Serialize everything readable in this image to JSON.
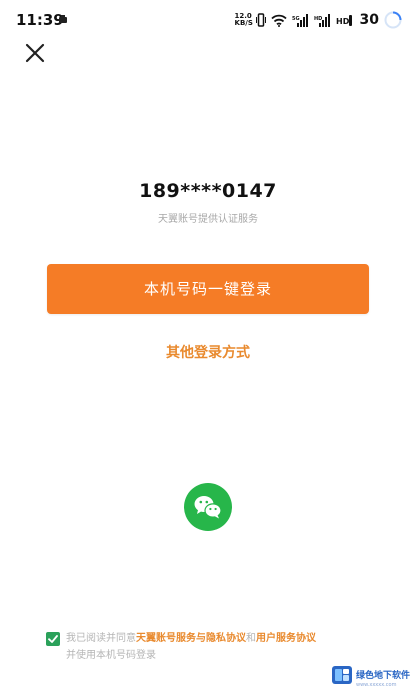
{
  "status_bar": {
    "time": "11:39",
    "net_speed_value": "12.0",
    "net_speed_unit": "KB/S",
    "battery": "30"
  },
  "login": {
    "phone_number": "189****0147",
    "auth_note": "天翼账号提供认证服务",
    "one_click_login_label": "本机号码一键登录",
    "other_login_label": "其他登录方式"
  },
  "agreement": {
    "prefix": "我已阅读并同意",
    "terms_link": "天翼账号服务与隐私协议",
    "conjunction": "和",
    "user_link": "用户服务协议",
    "line2": "并使用本机号码登录",
    "checked": true
  },
  "watermark": {
    "text": "绿色地下软件",
    "sub": "www.xxxxx.com"
  },
  "colors": {
    "primary": "#f57c26",
    "link": "#e98a2e",
    "wechat": "#27b64a",
    "checkbox": "#2aa15a"
  }
}
